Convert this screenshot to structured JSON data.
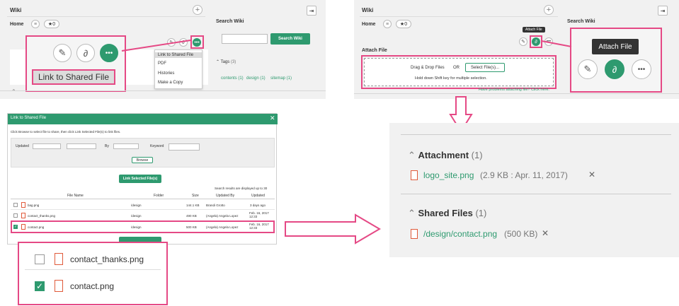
{
  "panel1": {
    "title": "Wiki",
    "home_label": "Home",
    "star_count": "0",
    "search_title": "Search Wiki",
    "search_button": "Search Wiki",
    "tags_label": "Tags",
    "tags_count": "(3)",
    "tags": [
      "contents (1)",
      "design (1)",
      "sitemap (1)"
    ],
    "menu": [
      "Link to Shared File",
      "PDF",
      "Histories",
      "Make a Copy"
    ],
    "zoom_label": "Link to Shared File"
  },
  "panel2": {
    "title": "Wiki",
    "home_label": "Home",
    "star_count": "0",
    "search_title": "Search Wiki",
    "tooltip": "Attach File",
    "attach_label": "Attach File",
    "drag_drop": "Drag & Drop Files",
    "or": "OR",
    "select_button": "Select File(s)...",
    "hint": "Hold down Shift key for multiple selection.",
    "problem_link": "Have problems attaching file? Click here.",
    "zoom_tooltip": "Attach File"
  },
  "dialog": {
    "title": "Link to Shared File",
    "instructions": "Click Browse to select file to share, then click Link Selected File(s) to link files.",
    "updated_label": "Updated",
    "by_label": "By",
    "keyword_label": "Keyword",
    "browse_button": "Browse",
    "link_button": "Link Selected File(s)",
    "results_note": "Search results are displayed up to 30",
    "columns": [
      "File Name",
      "Folder",
      "Size",
      "Updated By",
      "Updated"
    ],
    "rows": [
      {
        "name": "bag.png",
        "folder": "/design",
        "size": "144.1 KB",
        "by": "Brandi Grotto",
        "updated": "3 days ago",
        "checked": false
      },
      {
        "name": "contact_thanks.png",
        "folder": "/design",
        "size": "490 KB",
        "by": "(Angela) Angela Lopez",
        "updated": "Feb. 16, 2017 12:33",
        "checked": false
      },
      {
        "name": "contact.png",
        "folder": "/design",
        "size": "500 KB",
        "by": "(Angela) Angela Lopez",
        "updated": "Feb. 16, 2017 12:33",
        "checked": true
      }
    ],
    "zoom_rows": [
      {
        "name": "contact_thanks.png",
        "checked": false
      },
      {
        "name": "contact.png",
        "checked": true
      }
    ]
  },
  "result": {
    "attachment_title": "Attachment",
    "attachment_count": "(1)",
    "attachment_file": "logo_site.png",
    "attachment_meta": "(2.9 KB : Apr. 11, 2017)",
    "shared_title": "Shared Files",
    "shared_count": "(1)",
    "shared_file": "/design/contact.png",
    "shared_meta": "(500 KB)"
  },
  "colors": {
    "accent": "#2e9a6f",
    "highlight": "#e54985",
    "panel": "#f1f1f1"
  }
}
